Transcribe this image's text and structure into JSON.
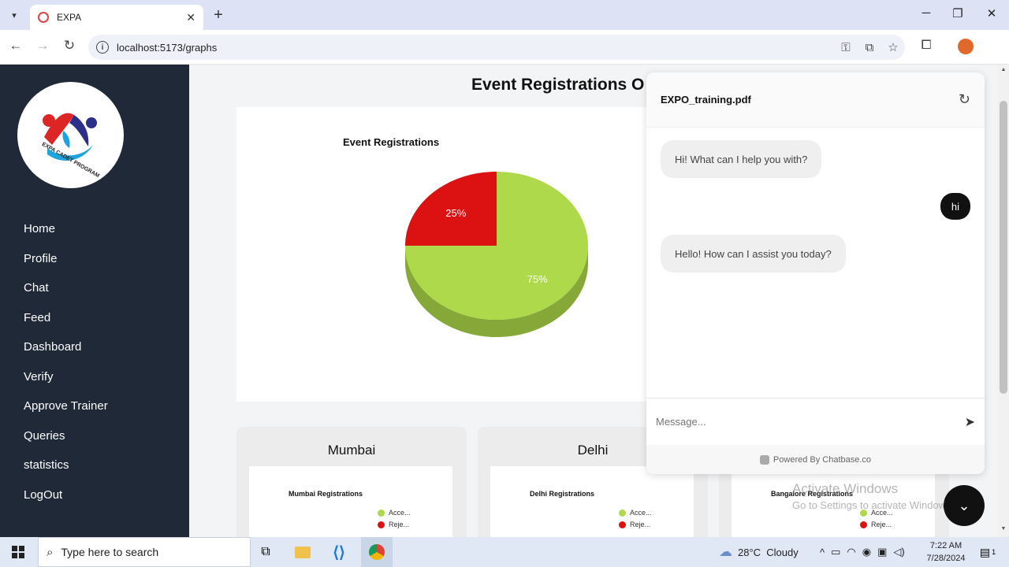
{
  "browser": {
    "tab_title": "EXPA",
    "url": "localhost:5173/graphs"
  },
  "sidebar": {
    "logo_text": "EXPA CADET PROGRAM",
    "items": [
      {
        "label": "Home"
      },
      {
        "label": "Profile"
      },
      {
        "label": "Chat"
      },
      {
        "label": "Feed"
      },
      {
        "label": "Dashboard"
      },
      {
        "label": "Verify"
      },
      {
        "label": "Approve Trainer"
      },
      {
        "label": "Queries"
      },
      {
        "label": "statistics"
      },
      {
        "label": "LogOut"
      }
    ]
  },
  "main": {
    "title": "Event Registrations O"
  },
  "chart_data": [
    {
      "type": "pie",
      "title": "Event Registrations",
      "labels": [
        "Accepted",
        "Rejected"
      ],
      "values": [
        75,
        25
      ],
      "slice_labels": [
        "75%",
        "25%"
      ],
      "colors": [
        "#aed94a",
        "#dc1212"
      ],
      "style": "3d"
    }
  ],
  "cities": [
    {
      "name": "Mumbai",
      "chart_title": "Mumbai Registrations",
      "legend": [
        "Acce...",
        "Reje..."
      ]
    },
    {
      "name": "Delhi",
      "chart_title": "Delhi Registrations",
      "legend": [
        "Acce...",
        "Reje..."
      ]
    },
    {
      "name": "",
      "chart_title": "Bangalore Registrations",
      "legend": [
        "Acce...",
        "Reje..."
      ]
    }
  ],
  "chatbot": {
    "file_name": "EXPO_training.pdf",
    "messages": [
      {
        "role": "bot",
        "text": "Hi! What can I help you with?"
      },
      {
        "role": "user",
        "text": "hi"
      },
      {
        "role": "bot",
        "text": "Hello! How can I assist you today?"
      }
    ],
    "input_placeholder": "Message...",
    "footer": "Powered By Chatbase.co"
  },
  "watermark": {
    "line1": "Activate Windows",
    "line2": "Go to Settings to activate Windows."
  },
  "taskbar": {
    "search_placeholder": "Type here to search",
    "weather_temp": "28°C",
    "weather_desc": "Cloudy",
    "time": "7:22 AM",
    "date": "7/28/2024",
    "notification_count": "1"
  },
  "colors": {
    "sidebar_bg": "#1f2937",
    "accepted": "#aed94a",
    "rejected": "#dc1212",
    "chat_dark": "#111111"
  }
}
